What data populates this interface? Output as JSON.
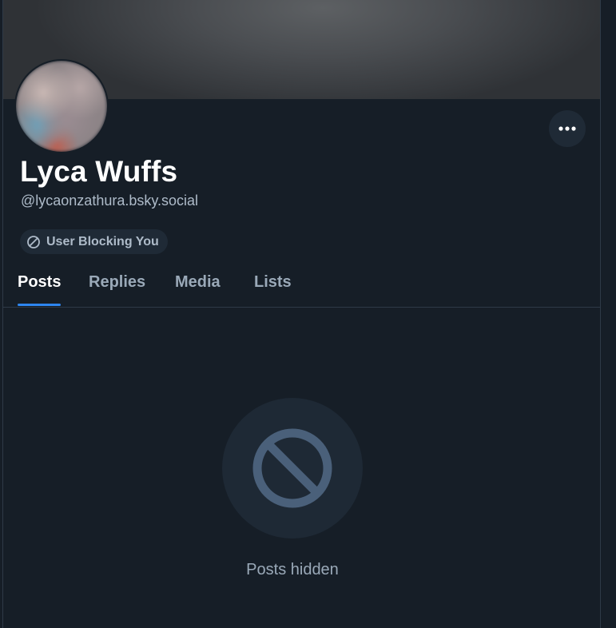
{
  "profile": {
    "display_name": "Lyca Wuffs",
    "handle": "@lycaonzathura.bsky.social",
    "badge": {
      "label": "User Blocking You",
      "icon": "block-icon"
    },
    "more_icon": "more-horizontal-icon"
  },
  "tabs": [
    {
      "label": "Posts",
      "active": true
    },
    {
      "label": "Replies",
      "active": false
    },
    {
      "label": "Media",
      "active": false
    },
    {
      "label": "Lists",
      "active": false
    }
  ],
  "content": {
    "empty_icon": "block-icon",
    "empty_message": "Posts hidden"
  },
  "colors": {
    "background": "#161e27",
    "accent": "#2e86f0",
    "muted_text": "#9aa9b8",
    "icon_gray": "#4a607a"
  }
}
